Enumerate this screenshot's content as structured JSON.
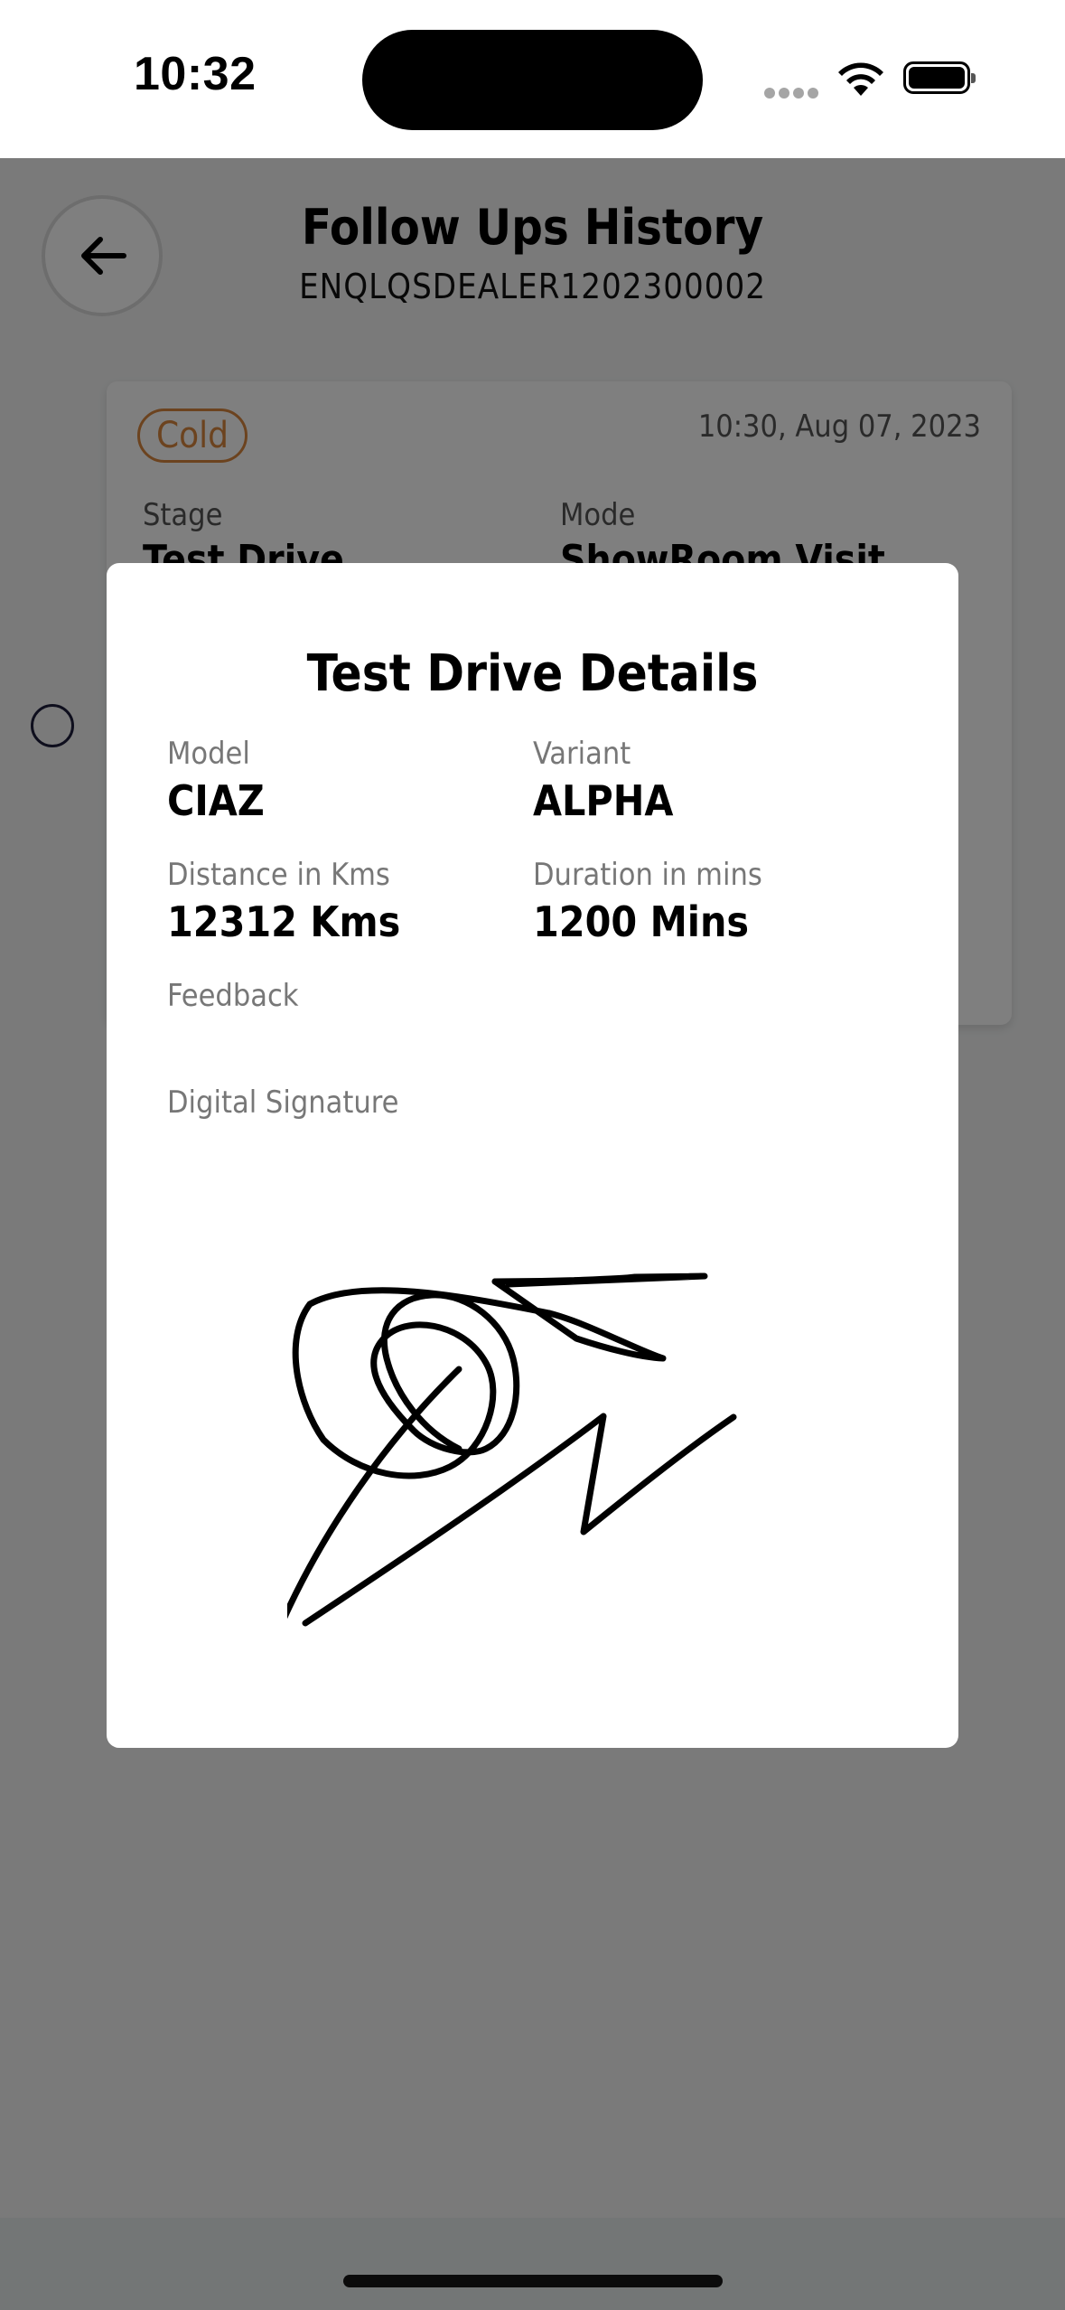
{
  "status_bar": {
    "time": "10:32"
  },
  "header": {
    "title": "Follow Ups History",
    "enquiry_id": "ENQLQSDEALER1202300002"
  },
  "followup_card": {
    "status_badge": "Cold",
    "timestamp": "10:30, Aug 07, 2023",
    "stage_label": "Stage",
    "stage_value": "Test Drive",
    "mode_label": "Mode",
    "mode_value": "ShowRoom Visit"
  },
  "modal": {
    "title": "Test Drive Details",
    "model_label": "Model",
    "model_value": "CIAZ",
    "variant_label": "Variant",
    "variant_value": "ALPHA",
    "distance_label": "Distance in Kms",
    "distance_value": "12312 Kms",
    "duration_label": "Duration in mins",
    "duration_value": "1200 Mins",
    "feedback_label": "Feedback",
    "feedback_value": "",
    "signature_label": "Digital Signature"
  },
  "colors": {
    "badge_cold": "#d8873e",
    "overlay": "rgba(0,0,0,0.5)",
    "card_bg": "#ffffff"
  },
  "icons": [
    "back-arrow-icon",
    "wifi-icon",
    "battery-icon",
    "cellular-signal-icon",
    "radio-button-icon"
  ]
}
